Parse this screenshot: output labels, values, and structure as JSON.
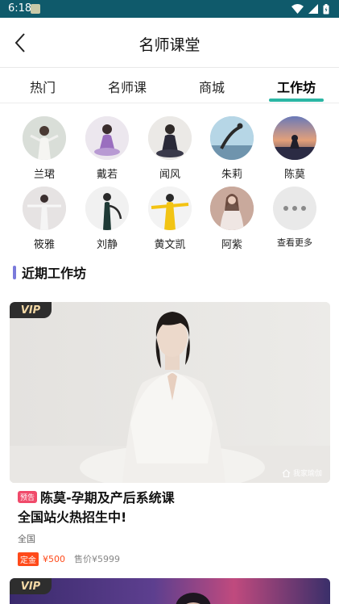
{
  "status_bar": {
    "time": "6:18"
  },
  "header": {
    "title": "名师课堂"
  },
  "tabs": [
    {
      "label": "热门"
    },
    {
      "label": "名师课"
    },
    {
      "label": "商城"
    },
    {
      "label": "工作坊",
      "active": true
    }
  ],
  "teachers": [
    {
      "name": "兰珺"
    },
    {
      "name": "戴若"
    },
    {
      "name": "闻风"
    },
    {
      "name": "朱莉"
    },
    {
      "name": "陈莫"
    },
    {
      "name": "筱雅"
    },
    {
      "name": "刘静"
    },
    {
      "name": "黄文凯"
    },
    {
      "name": "阿紫"
    }
  ],
  "more": {
    "label": "查看更多"
  },
  "section": {
    "title": "近期工作坊"
  },
  "course": {
    "badge": "VIP",
    "watermark": "我家瑜伽",
    "tag": "预告",
    "title": "陈莫-孕期及产后系统课",
    "subtitle": "全国站火热招生中!",
    "region": "全国",
    "deposit_label": "定金",
    "deposit_price": "¥500",
    "sale_price": "售价¥5999"
  },
  "course2": {
    "badge": "VIP"
  },
  "colors": {
    "status_bar": "#0f5a6b",
    "tab_accent": "#2bb6a4",
    "section_accent": "#7a7adb",
    "price": "#ff4a1a",
    "tag": "#f04a6a"
  }
}
